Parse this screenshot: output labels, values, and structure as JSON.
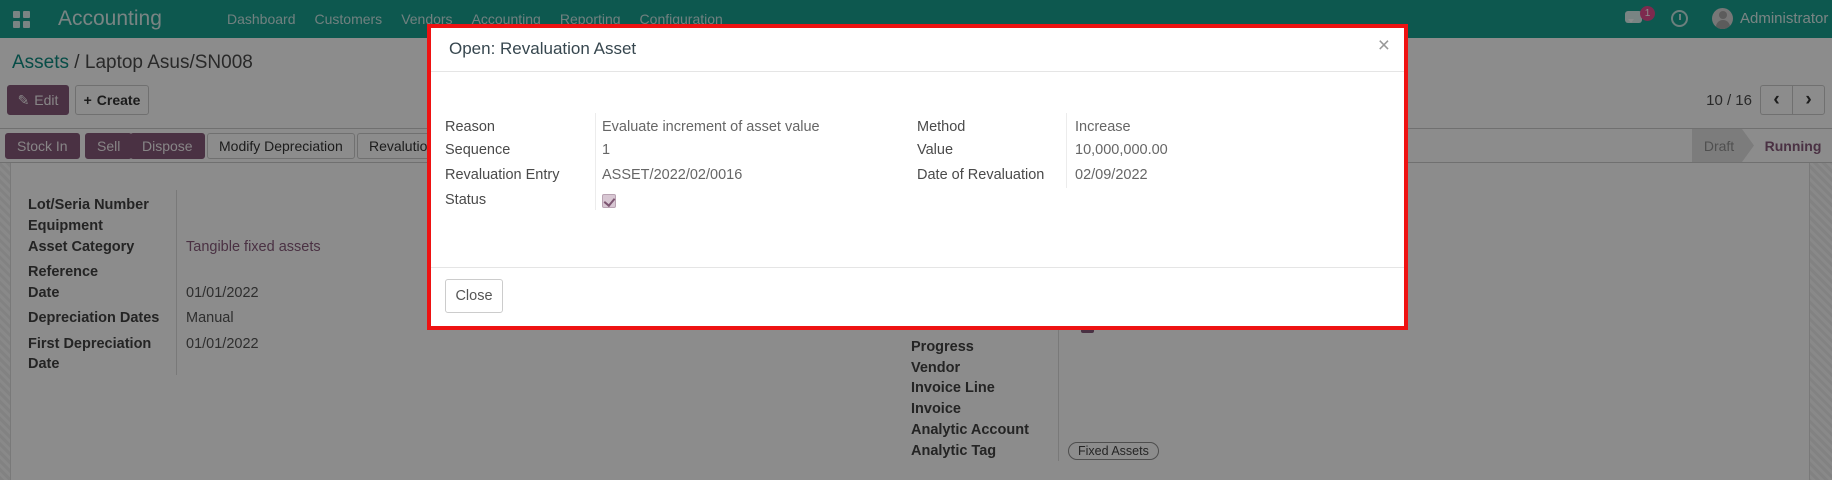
{
  "nav": {
    "brand": "Accounting",
    "items": [
      {
        "label": "Dashboard"
      },
      {
        "label": "Customers"
      },
      {
        "label": "Vendors"
      },
      {
        "label": "Accounting"
      },
      {
        "label": "Reporting"
      },
      {
        "label": "Configuration"
      }
    ],
    "messages_badge": "1",
    "user": "Administrator"
  },
  "breadcrumb": {
    "parent": "Assets",
    "separator": " / ",
    "current": "Laptop Asus/SN008"
  },
  "control_panel": {
    "edit": "Edit",
    "edit_icon": "✎",
    "create": "Create",
    "create_icon": "+",
    "pager": "10 / 16",
    "prev": "‹",
    "next": "›"
  },
  "action_buttons": {
    "stock_in": "Stock In",
    "sell": "Sell",
    "dispose": "Dispose",
    "modify_depreciation": "Modify Depreciation",
    "revaluation": "Revalutio"
  },
  "statusbar": {
    "draft": "Draft",
    "running": "Running"
  },
  "form": {
    "left": {
      "lot_label": "Lot/Seria Number",
      "equipment_label": "Equipment",
      "asset_category_label": "Asset Category",
      "asset_category_value": "Tangible fixed assets",
      "reference_label": "Reference",
      "date_label": "Date",
      "date_value": "01/01/2022",
      "depreciation_dates_label": "Depreciation Dates",
      "depreciation_dates_value": "Manual",
      "first_depreciation_label": "First Depreciation Date",
      "first_depreciation_value": "01/01/2022"
    },
    "right": {
      "progress_label": "Progress",
      "vendor_label": "Vendor",
      "invoice_line_label": "Invoice Line",
      "invoice_label": "Invoice",
      "analytic_account_label": "Analytic Account",
      "analytic_tag_label": "Analytic Tag",
      "analytic_tag_value": "Fixed Assets"
    }
  },
  "modal": {
    "title": "Open: Revaluation Asset",
    "close_x": "×",
    "reason_label": "Reason",
    "reason_value": "Evaluate increment of asset value",
    "sequence_label": "Sequence",
    "sequence_value": "1",
    "revaluation_entry_label": "Revaluation Entry",
    "revaluation_entry_value": "ASSET/2022/02/0016",
    "status_label": "Status",
    "status_checked": "true",
    "method_label": "Method",
    "method_value": "Increase",
    "value_label": "Value",
    "value_value": "10,000,000.00",
    "date_label": "Date of Revaluation",
    "date_value": "02/09/2022",
    "close_button": "Close"
  },
  "colors": {
    "nav_teal": "#18a091",
    "accent_purple": "#875A7B",
    "annotation_red": "#ee1212",
    "link_teal": "#0e8c82",
    "badge_pink": "#e34e8e"
  }
}
